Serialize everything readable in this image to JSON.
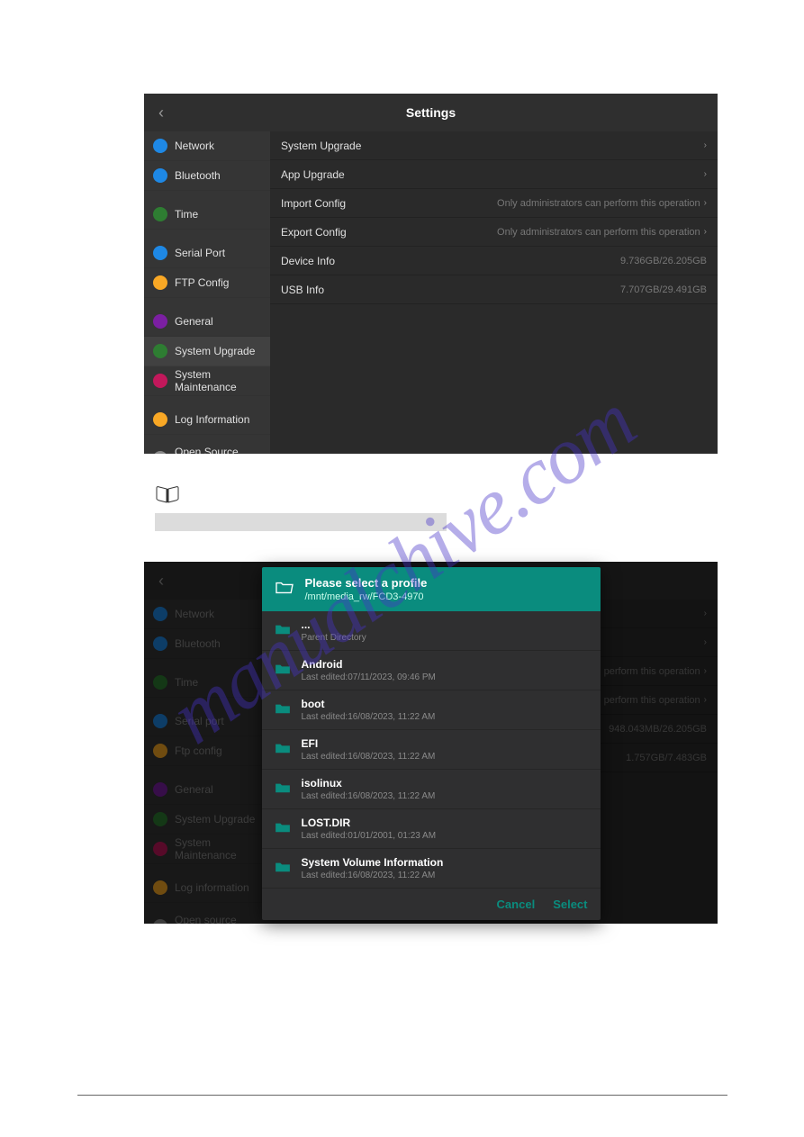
{
  "watermark": "manualchive.com",
  "header": {
    "title": "Settings"
  },
  "sidebar1": [
    {
      "label": "Network",
      "color": "#1e88e5"
    },
    {
      "label": "Bluetooth",
      "color": "#1e88e5"
    },
    {
      "label": "Time",
      "color": "#2e7d32",
      "gap": true
    },
    {
      "label": "Serial Port",
      "color": "#1e88e5",
      "gap": true
    },
    {
      "label": "FTP Config",
      "color": "#f9a825"
    },
    {
      "label": "General",
      "color": "#7b1fa2",
      "gap": true
    },
    {
      "label": "System Upgrade",
      "color": "#2e7d32",
      "active": true
    },
    {
      "label": "System Maintenance",
      "color": "#c2185b"
    },
    {
      "label": "Log Information",
      "color": "#f9a825",
      "gap": true
    },
    {
      "label": "Open Source Software",
      "color": "#888",
      "gap": true
    }
  ],
  "main1": [
    {
      "label": "System Upgrade",
      "value": "",
      "chev": true
    },
    {
      "label": "App Upgrade",
      "value": "",
      "chev": true
    },
    {
      "label": "Import Config",
      "value": "Only administrators can perform this operation",
      "chev": true
    },
    {
      "label": "Export Config",
      "value": "Only administrators can perform this operation",
      "chev": true
    },
    {
      "label": "Device Info",
      "value": "9.736GB/26.205GB",
      "chev": false
    },
    {
      "label": "USB Info",
      "value": "7.707GB/29.491GB",
      "chev": false
    }
  ],
  "sidebar2": [
    {
      "label": "Network",
      "color": "#1e88e5"
    },
    {
      "label": "Bluetooth",
      "color": "#1e88e5"
    },
    {
      "label": "Time",
      "color": "#2e7d32",
      "gap": true
    },
    {
      "label": "Serial port",
      "color": "#1e88e5",
      "gap": true
    },
    {
      "label": "Ftp config",
      "color": "#f9a825"
    },
    {
      "label": "General",
      "color": "#7b1fa2",
      "gap": true
    },
    {
      "label": "System Upgrade",
      "color": "#2e7d32"
    },
    {
      "label": "System Maintenance",
      "color": "#c2185b"
    },
    {
      "label": "Log information",
      "color": "#f9a825",
      "gap": true
    },
    {
      "label": "Open source software",
      "color": "#888",
      "gap": true
    }
  ],
  "main2": [
    {
      "label": "",
      "value": "",
      "chev": true
    },
    {
      "label": "",
      "value": "",
      "chev": true
    },
    {
      "label": "",
      "value": "perform this operation",
      "chev": true
    },
    {
      "label": "",
      "value": "perform this operation",
      "chev": true
    },
    {
      "label": "",
      "value": "948.043MB/26.205GB",
      "chev": false
    },
    {
      "label": "",
      "value": "1.757GB/7.483GB",
      "chev": false
    }
  ],
  "dialog": {
    "title": "Please select a profile",
    "path": "/mnt/media_rw/FCD3-4970",
    "files": [
      {
        "name": "...",
        "meta": "Parent Directory"
      },
      {
        "name": "Android",
        "meta": "Last edited:07/11/2023, 09:46 PM"
      },
      {
        "name": "boot",
        "meta": "Last edited:16/08/2023, 11:22 AM"
      },
      {
        "name": "EFI",
        "meta": "Last edited:16/08/2023, 11:22 AM"
      },
      {
        "name": "isolinux",
        "meta": "Last edited:16/08/2023, 11:22 AM"
      },
      {
        "name": "LOST.DIR",
        "meta": "Last edited:01/01/2001, 01:23 AM"
      },
      {
        "name": "System Volume Information",
        "meta": "Last edited:16/08/2023, 11:22 AM"
      }
    ],
    "cancel": "Cancel",
    "select": "Select"
  }
}
